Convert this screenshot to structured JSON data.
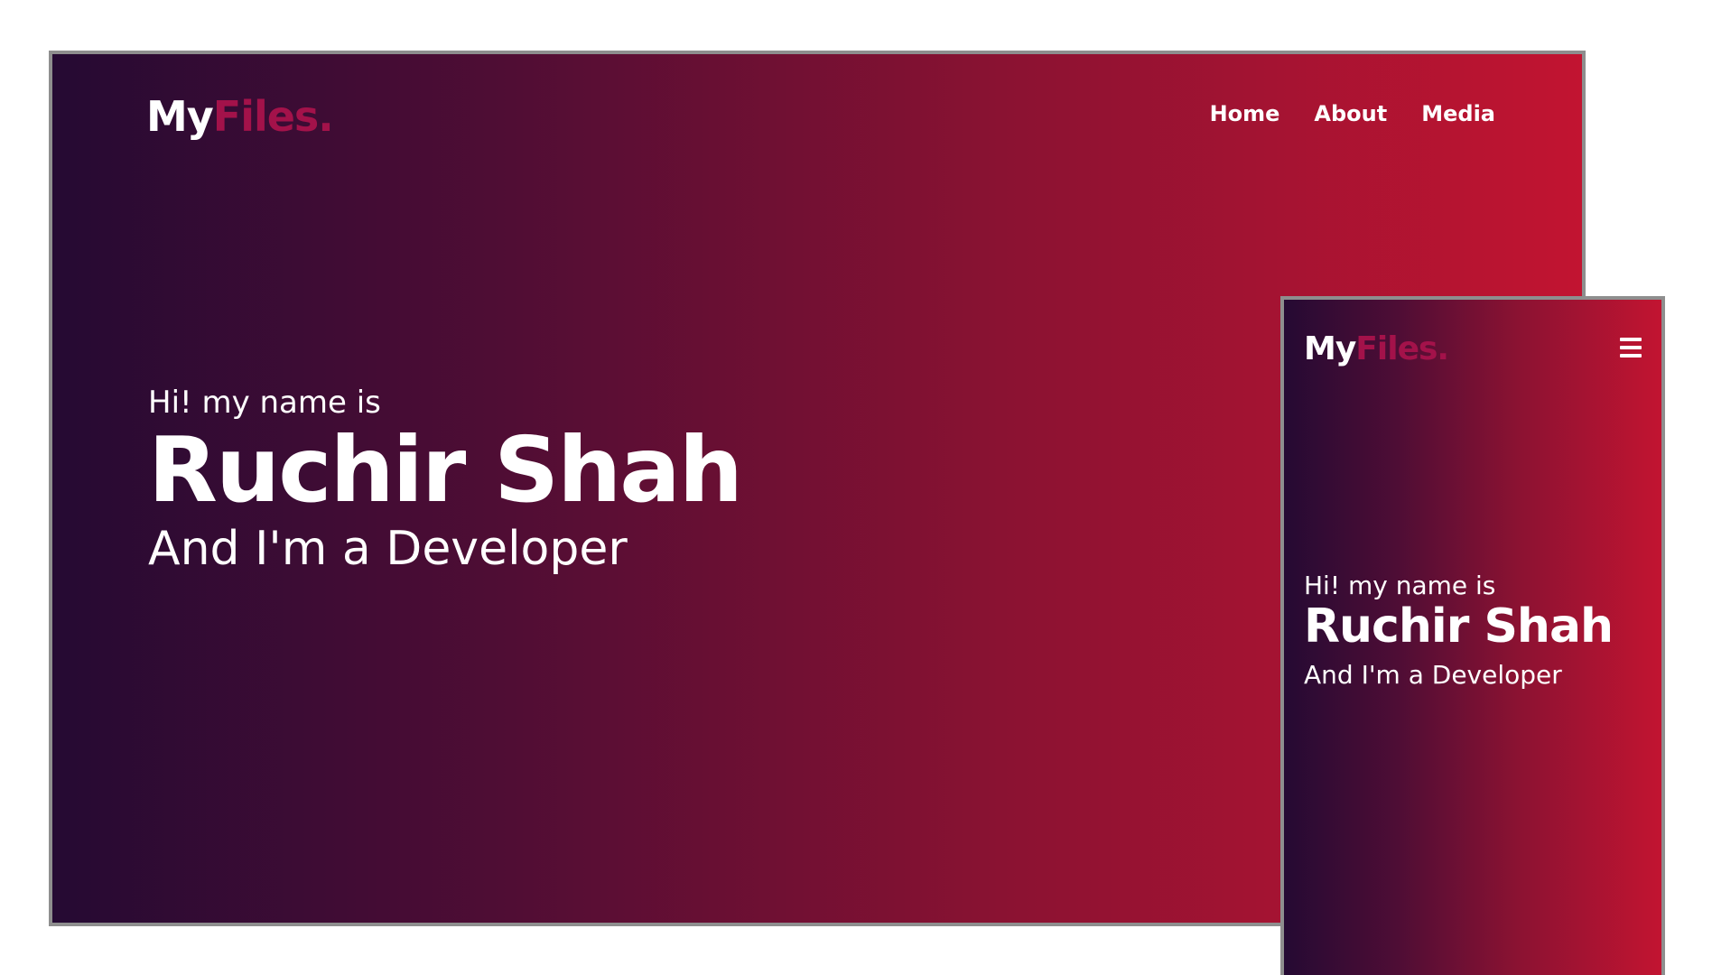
{
  "brand": {
    "logo_my": "My",
    "logo_files": "Files."
  },
  "nav": {
    "items": [
      {
        "label": "Home"
      },
      {
        "label": "About"
      },
      {
        "label": "Media"
      }
    ]
  },
  "hero": {
    "intro": "Hi! my name is",
    "name": "Ruchir Shah",
    "role": "And I'm a Developer"
  },
  "colors": {
    "gradient_start": "#250a33",
    "gradient_end": "#c21431",
    "logo_accent": "#a3124a",
    "text": "#ffffff",
    "frame_border": "#8e8e8e"
  },
  "icons": {
    "mobile_menu": "hamburger-menu-icon"
  }
}
